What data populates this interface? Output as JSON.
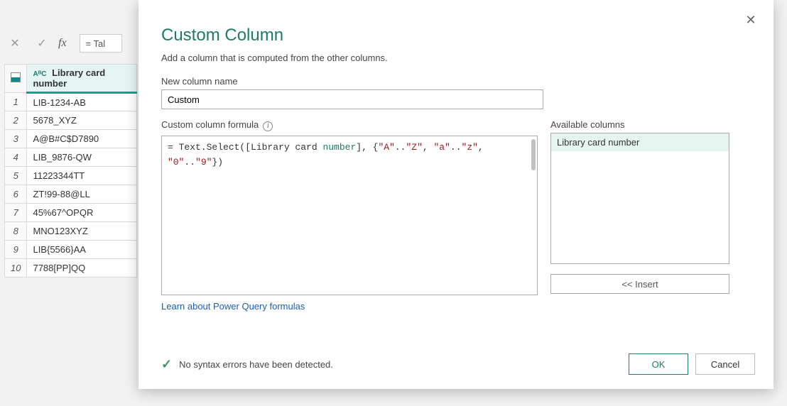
{
  "formula_bar": {
    "text": "= Tal"
  },
  "grid": {
    "column_header": "Library card number",
    "type_label": "AᴮC",
    "rows": [
      "LIB-1234-AB",
      "5678_XYZ",
      "A@B#C$D7890",
      "LIB_9876-QW",
      "11223344TT",
      "ZT!99-88@LL",
      "45%67^OPQR",
      "MNO123XYZ",
      "LIB{5566}AA",
      "7788[PP]QQ"
    ]
  },
  "dialog": {
    "title": "Custom Column",
    "subtitle": "Add a column that is computed from the other columns.",
    "new_col_label": "New column name",
    "new_col_value": "Custom",
    "formula_label": "Custom column formula",
    "formula": {
      "prefix": "= Text.Select(",
      "field_open": "[Library card ",
      "field_name": "number",
      "field_close": "]",
      "sep1": ", {",
      "s1a": "\"A\"",
      "dd1": "..",
      "s1b": "\"Z\"",
      "sep2": ", ",
      "s2a": "\"a\"",
      "dd2": "..",
      "s2b": "\"z\"",
      "sep3": ",",
      "line2_indent": "   ",
      "s3a": "\"0\"",
      "dd3": "..",
      "s3b": "\"9\"",
      "close": "})"
    },
    "link": "Learn about Power Query formulas",
    "available_label": "Available columns",
    "available_items": [
      "Library card number"
    ],
    "insert_label": "<< Insert",
    "status_text": "No syntax errors have been detected.",
    "ok_label": "OK",
    "cancel_label": "Cancel"
  }
}
